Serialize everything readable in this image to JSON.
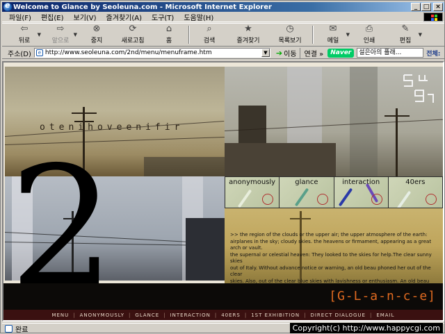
{
  "window": {
    "title": "Welcome to Glance by Seoleuna.com - Microsoft Internet Explorer",
    "buttons": {
      "minimize": "_",
      "maximize": "□",
      "close": "×"
    }
  },
  "menubar": {
    "items": [
      "파일(F)",
      "편집(E)",
      "보기(V)",
      "즐겨찾기(A)",
      "도구(T)",
      "도움말(H)"
    ]
  },
  "toolbar": {
    "back": "뒤로",
    "forward": "앞으로",
    "stop": "중지",
    "refresh": "새로고침",
    "home": "홈",
    "search": "검색",
    "favorites": "즐겨찾기",
    "history": "목록보기",
    "mail": "메일",
    "print": "인쇄",
    "edit": "편집"
  },
  "address": {
    "label": "주소(D)",
    "url": "http://www.seoleuna.com/2nd/menu/menuframe.htm",
    "go": "이동",
    "links": "연결 »",
    "naver_logo": "Naver",
    "naver_search": "설은아의 플래...",
    "naver_all": "전체:"
  },
  "page": {
    "scattered_text": "otenihoveenifir",
    "big_number": "2",
    "tiles": [
      "anonymously",
      "glance",
      "interaction",
      "40ers"
    ],
    "text_lines": [
      ">> the region of the clouds or the upper air; the upper atmosphere of the earth:",
      "airplanes in the sky; cloudy skies. the heavens or firmament, appearing as a great arch or vault.",
      "the supernal or celestial heaven: They  looked to the skies for help.The clear sunny skies",
      "out of Italy. Without advance notice or warning, an old beau phoned her out of the clear",
      "skies. Also, out of the clear blue skies with lavishness or enthusiasm. An old beau phoned"
    ],
    "glance_logo": "[G-L-a-n-c-e]",
    "nav": [
      "MENU",
      "ANONYMOUSLY",
      "GLANCE",
      "INTERACTION",
      "40ERS",
      "1ST EXHIBITION",
      "DIRECT DIALOGUE",
      "EMAIL"
    ]
  },
  "status": {
    "text": "완료",
    "copyright": "Copyright(c) http://www.happycgi.com"
  },
  "colors": {
    "titlebar": "#0a246a",
    "accent_orange": "#e06a20",
    "nav_bg": "#3a1010"
  }
}
